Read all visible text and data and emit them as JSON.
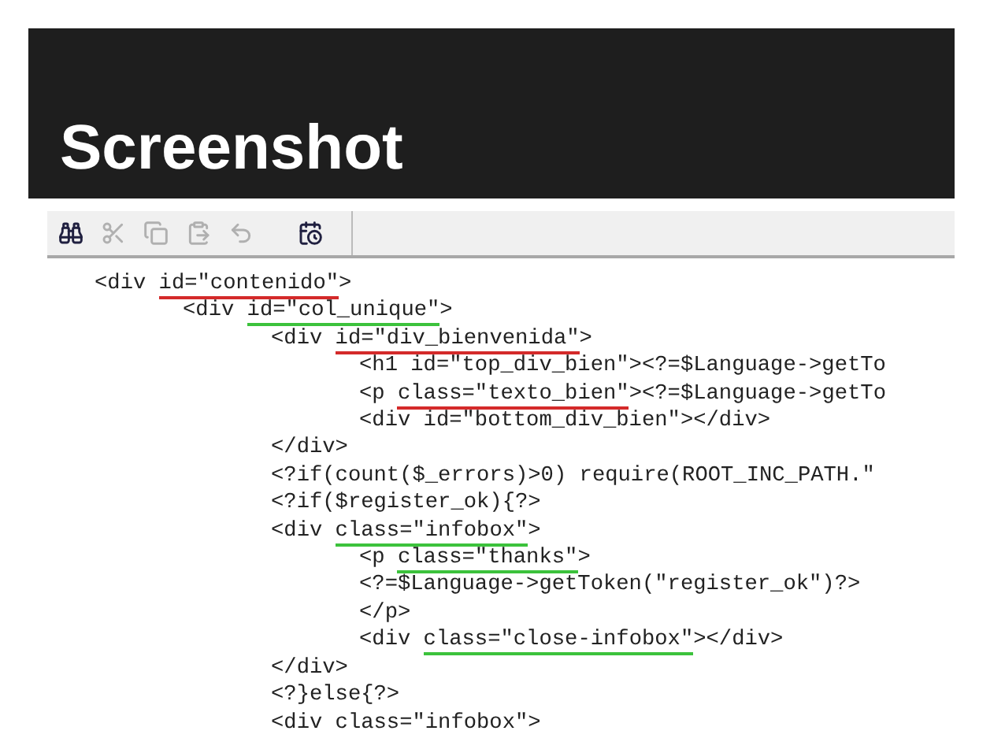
{
  "slide": {
    "title": "Screenshot"
  },
  "toolbar": [
    {
      "kind": "find",
      "disabled": false
    },
    {
      "kind": "cut",
      "disabled": true
    },
    {
      "kind": "copy",
      "disabled": true
    },
    {
      "kind": "paste",
      "disabled": true
    },
    {
      "kind": "undo",
      "disabled": true
    },
    {
      "kind": "schedule",
      "disabled": false
    }
  ],
  "code_lines": [
    {
      "parts": [
        {
          "text": "<div "
        },
        {
          "text": "id=\"contenido\"",
          "color": "#d42a2a"
        },
        {
          "text": ">"
        }
      ],
      "children": [
        {
          "parts": [
            {
              "text": "<div "
            },
            {
              "text": "id=\"col_unique\"",
              "color": "#3cc23c"
            },
            {
              "text": ">"
            }
          ],
          "children": [
            {
              "parts": [
                {
                  "text": "<div "
                },
                {
                  "text": "id=\"div_bienvenida\"",
                  "color": "#d42a2a"
                },
                {
                  "text": ">"
                }
              ],
              "children": [
                {
                  "parts": [
                    {
                      "text": "<h1 id=\"top_div_bien\"><?=$Language->getTo"
                    }
                  ]
                },
                {
                  "parts": [
                    {
                      "text": "<p "
                    },
                    {
                      "text": "class=\"texto_bien\"",
                      "color": "#d42a2a"
                    },
                    {
                      "text": "><?=$Language->getTo"
                    }
                  ]
                },
                {
                  "parts": [
                    {
                      "text": "<div id=\"bottom_div_bien\"></div>"
                    }
                  ]
                }
              ]
            },
            {
              "parts": [
                {
                  "text": "</div>"
                }
              ]
            },
            {
              "parts": [
                {
                  "text": "<?if(count($_errors)>0) require(ROOT_INC_PATH.\""
                }
              ]
            },
            {
              "parts": [
                {
                  "text": "<?if($register_ok){?>"
                }
              ]
            },
            {
              "parts": [
                {
                  "text": "<div "
                },
                {
                  "text": "class=\"infobox\"",
                  "color": "#3cc23c"
                },
                {
                  "text": ">"
                }
              ],
              "children": [
                {
                  "parts": [
                    {
                      "text": "<p "
                    },
                    {
                      "text": "class=\"thanks\"",
                      "color": "#3cc23c"
                    },
                    {
                      "text": ">"
                    }
                  ]
                },
                {
                  "parts": [
                    {
                      "text": "<?=$Language->getToken(\"register_ok\")?>"
                    }
                  ]
                },
                {
                  "parts": [
                    {
                      "text": "</p>"
                    }
                  ]
                },
                {
                  "parts": [
                    {
                      "text": "<div "
                    },
                    {
                      "text": "class=\"close-infobox\"",
                      "color": "#3cc23c"
                    },
                    {
                      "text": "></div>"
                    }
                  ]
                }
              ]
            },
            {
              "parts": [
                {
                  "text": "</div>"
                }
              ]
            },
            {
              "parts": [
                {
                  "text": "<?}else{?>"
                }
              ]
            },
            {
              "parts": [
                {
                  "text": "<div class=\"infobox\">"
                }
              ]
            }
          ]
        }
      ]
    }
  ]
}
